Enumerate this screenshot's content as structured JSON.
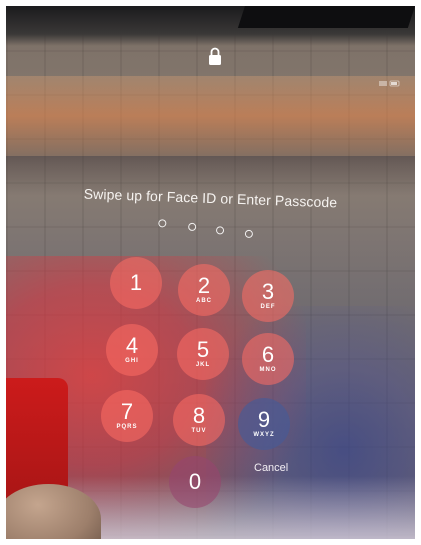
{
  "lock_screen": {
    "lock_icon": "lock-icon",
    "prompt": "Swipe up for Face ID or Enter Passcode",
    "passcode_dots": 4,
    "cancel_label": "Cancel"
  },
  "keypad": [
    {
      "num": "1",
      "letters": ""
    },
    {
      "num": "2",
      "letters": "ABC"
    },
    {
      "num": "3",
      "letters": "DEF"
    },
    {
      "num": "4",
      "letters": "GHI"
    },
    {
      "num": "5",
      "letters": "JKL"
    },
    {
      "num": "6",
      "letters": "MNO"
    },
    {
      "num": "7",
      "letters": "PQRS"
    },
    {
      "num": "8",
      "letters": "TUV"
    },
    {
      "num": "9",
      "letters": "WXYZ"
    },
    {
      "num": "0",
      "letters": ""
    }
  ]
}
